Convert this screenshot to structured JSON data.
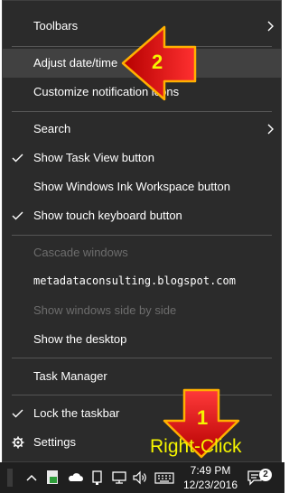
{
  "menu": {
    "items": [
      {
        "label": "Toolbars",
        "submenu": true
      },
      {
        "label": "Adjust date/time"
      },
      {
        "label": "Customize notification icons"
      },
      {
        "label": "Search",
        "submenu": true
      },
      {
        "label": "Show Task View button",
        "checked": true
      },
      {
        "label": "Show Windows Ink Workspace button"
      },
      {
        "label": "Show touch keyboard button",
        "checked": true
      },
      {
        "label": "Cascade windows",
        "disabled": true
      },
      {
        "label": "metadataconsulting.blogspot.com"
      },
      {
        "label": "Show windows side by side",
        "disabled": true
      },
      {
        "label": "Show the desktop"
      },
      {
        "label": "Task Manager"
      },
      {
        "label": "Lock the taskbar",
        "checked": true
      },
      {
        "label": "Settings",
        "icon": "gear-icon"
      }
    ]
  },
  "annotations": {
    "step2": "2",
    "step1": "1",
    "right_click": "Right-Click",
    "arrow_color": "#e8161b",
    "arrow_outline": "#ffb000",
    "label_color": "#f5f500"
  },
  "taskbar": {
    "time": "7:49 PM",
    "date": "12/23/2016",
    "notification_count": "2",
    "icons": [
      "chevron-up-icon",
      "app-icon",
      "onedrive-cloud-icon",
      "device-icon",
      "network-icon",
      "volume-icon",
      "keyboard-icon",
      "action-center-icon"
    ]
  }
}
